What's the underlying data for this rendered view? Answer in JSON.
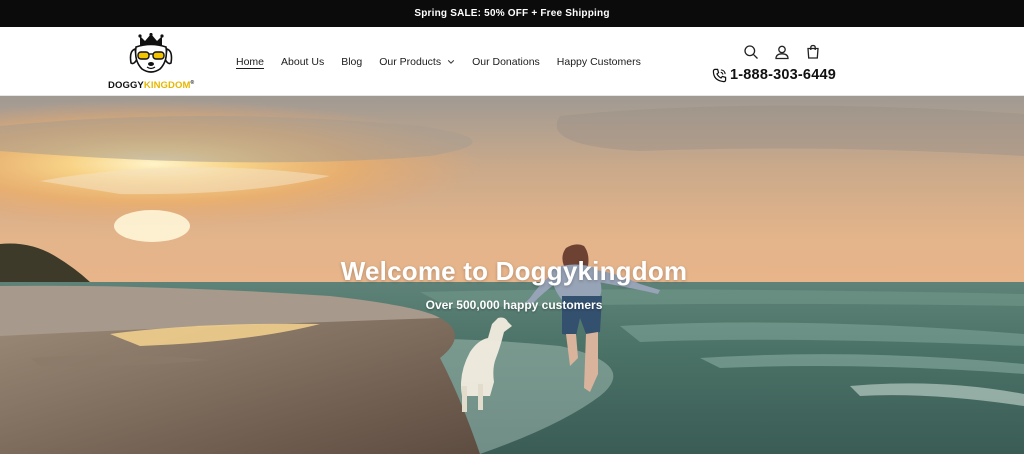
{
  "announcement": {
    "text": "Spring SALE: 50% OFF + Free Shipping"
  },
  "logo": {
    "text_dark": "DOGGY",
    "text_gold": "KINGDOM",
    "registered": "®"
  },
  "nav": {
    "items": [
      {
        "label": "Home",
        "active": true
      },
      {
        "label": "About Us"
      },
      {
        "label": "Blog"
      },
      {
        "label": "Our Products",
        "has_dropdown": true
      },
      {
        "label": "Our Donations"
      },
      {
        "label": "Happy Customers"
      }
    ]
  },
  "header_icons": [
    "search-icon",
    "account-icon",
    "cart-icon"
  ],
  "phone": {
    "number": "1-888-303-6449",
    "icon": "phone-icon"
  },
  "hero": {
    "title": "Welcome to Doggykingdom",
    "subtitle": "Over 500,000 happy customers"
  },
  "colors": {
    "announcement_bg": "#0b0b0b",
    "logo_gold": "#e6b800",
    "text_dark": "#1c1c1c"
  }
}
